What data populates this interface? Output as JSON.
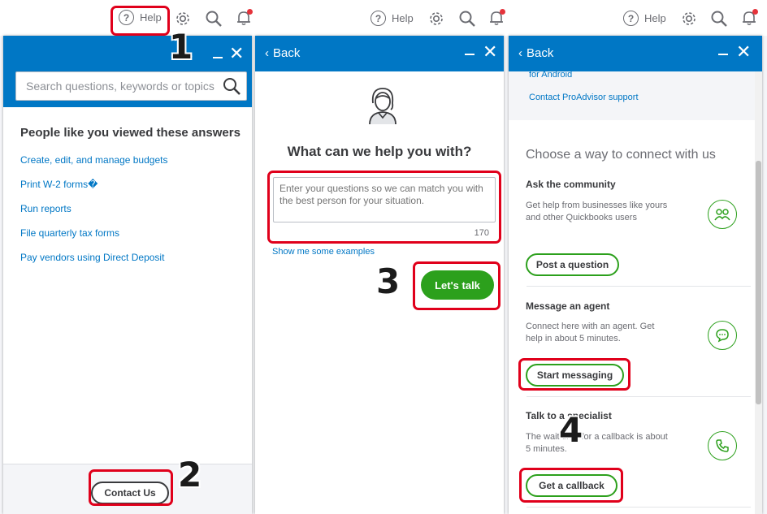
{
  "topbar": {
    "help_label": "Help",
    "icons": [
      "help-circle-icon",
      "gear-icon",
      "search-icon",
      "bell-icon"
    ]
  },
  "panel1": {
    "search_placeholder": "Search questions, keywords or topics",
    "people_title": "People like you viewed these answers",
    "answers": [
      "Create, edit, and manage budgets",
      "Print W-2 forms�",
      "Run reports",
      "File quarterly tax forms",
      "Pay vendors using Direct Deposit"
    ],
    "contact_label": "Contact Us"
  },
  "panel2": {
    "back_label": "Back",
    "title": "What can we help you with?",
    "question_placeholder": "Enter your questions so we can match you with the best person for your situation.",
    "counter": "170",
    "examples_link": "Show me some examples",
    "lets_talk_label": "Let's talk"
  },
  "panel3": {
    "back_label": "Back",
    "link_android": "for Android",
    "link_proadvisor": "Contact ProAdvisor support",
    "choose_title": "Choose a way to connect with us",
    "community": {
      "title": "Ask the community",
      "desc": "Get help from businesses like yours and other Quickbooks users",
      "button": "Post a question"
    },
    "message": {
      "title": "Message an agent",
      "desc": "Connect here with an agent. Get help in about 5 minutes.",
      "button": "Start messaging"
    },
    "specialist": {
      "title": "Talk to a specialist",
      "desc": "The wait time for a callback is about 5 minutes.",
      "button": "Get a callback"
    }
  },
  "steps": [
    "1",
    "2",
    "3",
    "4"
  ],
  "colors": {
    "header_blue": "#0077c5",
    "link_blue": "#0077c5",
    "brand_green": "#2ca01c",
    "annotation_red": "#e0001b"
  }
}
